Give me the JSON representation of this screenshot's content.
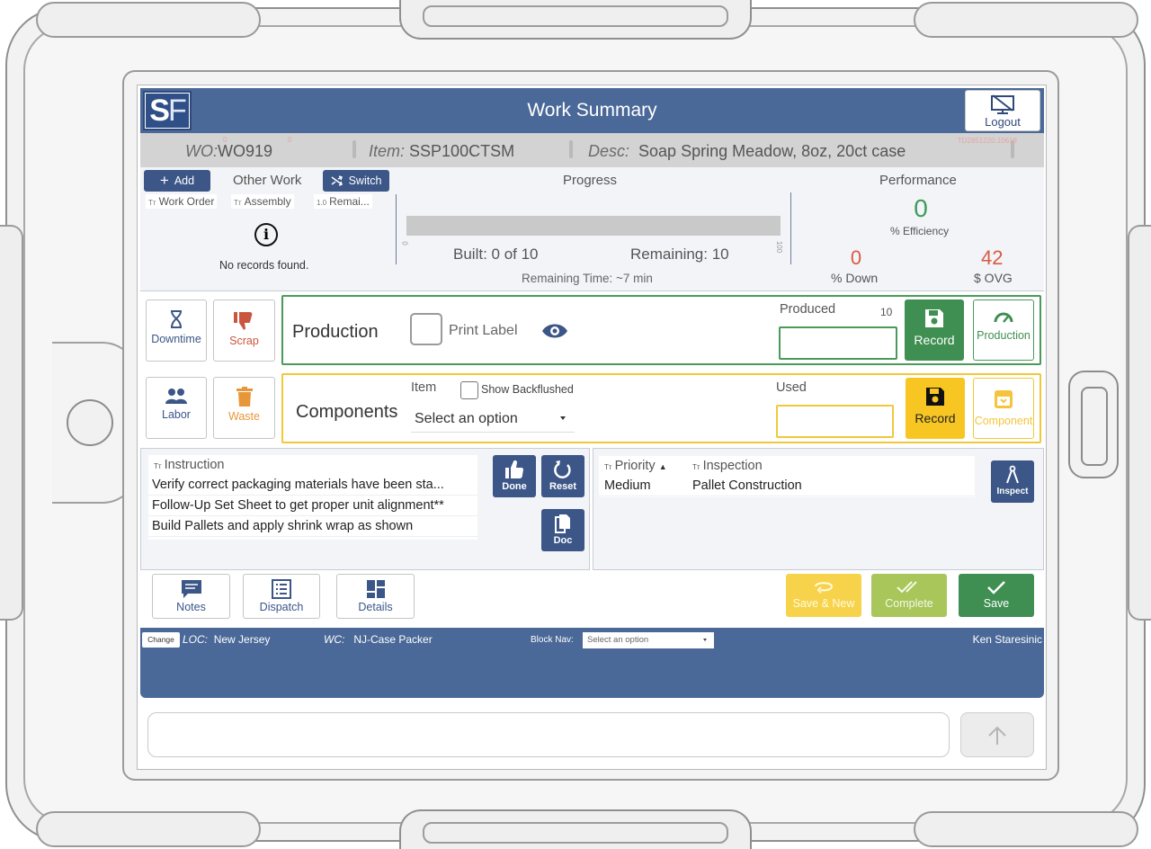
{
  "header": {
    "logo_s": "S",
    "logo_f": "F",
    "title": "Work Summary",
    "logout_label": "Logout"
  },
  "infobar": {
    "wo_label": "WO:",
    "wo_value": "WO919",
    "item_label": "Item:",
    "item_value": "SSP100CTSM",
    "desc_label": "Desc:",
    "desc_value": "Soap Spring Meadow, 8oz, 20ct case",
    "small_zero_1": "0",
    "small_zero_2": "0",
    "code": "TD2851220.10618"
  },
  "other_work": {
    "add_label": "Add",
    "title": "Other Work",
    "switch_label": "Switch",
    "columns": [
      "Work Order",
      "Assembly",
      "Remai..."
    ],
    "column_prefixes": [
      "Tт",
      "Tт",
      "1.0"
    ],
    "empty_message": "No records found."
  },
  "progress": {
    "title": "Progress",
    "built_text": "Built: 0 of 10",
    "remaining_text": "Remaining: 10",
    "remaining_time": "Remaining Time: ~7 min",
    "built": 0,
    "total": 10,
    "scale_min": "0",
    "scale_max": "100"
  },
  "performance": {
    "title": "Performance",
    "efficiency_value": "0",
    "efficiency_label": "% Efficiency",
    "down_value": "0",
    "down_label": "% Down",
    "ovg_value": "42",
    "ovg_label": "$ OVG"
  },
  "tiles": {
    "downtime": "Downtime",
    "scrap": "Scrap",
    "labor": "Labor",
    "waste": "Waste"
  },
  "production": {
    "title": "Production",
    "print_label": "Print Label",
    "produced_label": "Produced",
    "produced_count": "10",
    "produced_value": "",
    "record_label": "Record",
    "production_btn_label": "Production"
  },
  "components": {
    "title": "Components",
    "item_label": "Item",
    "show_backflushed": "Show Backflushed",
    "select_placeholder": "Select an option",
    "used_label": "Used",
    "used_value": "",
    "record_label": "Record",
    "component_btn_label": "Component"
  },
  "instructions": {
    "header_prefix": "Tт",
    "header": "Instruction",
    "rows": [
      "Verify correct packaging materials have been sta...",
      "Follow-Up Set Sheet to get proper unit alignment**",
      "Build Pallets and apply shrink wrap as shown"
    ],
    "done_label": "Done",
    "reset_label": "Reset",
    "doc_label": "Doc"
  },
  "inspection": {
    "priority_prefix": "Tт",
    "priority_header": "Priority",
    "inspection_prefix": "Tт",
    "inspection_header": "Inspection",
    "rows": [
      {
        "priority": "Medium",
        "inspection": "Pallet Construction"
      }
    ],
    "inspect_label": "Inspect"
  },
  "footer": {
    "notes": "Notes",
    "dispatch": "Dispatch",
    "details": "Details",
    "save_new": "Save & New",
    "complete": "Complete",
    "save": "Save"
  },
  "status_bar": {
    "change_label": "Change",
    "loc_label": "LOC:",
    "loc_value": "New Jersey",
    "wc_label": "WC:",
    "wc_value": "NJ-Case Packer",
    "block_nav_label": "Block Nav:",
    "block_nav_placeholder": "Select an option",
    "user": "Ken Staresinic"
  },
  "chat": {
    "input_value": ""
  },
  "colors": {
    "brand_navy": "#4a6898",
    "button_navy": "#3b5687",
    "success_green": "#3f8f52",
    "record_yellow": "#f7c623",
    "save_new_yellow": "#f7d34b",
    "complete_green": "#a8c65a",
    "alert_red": "#d95a46"
  }
}
